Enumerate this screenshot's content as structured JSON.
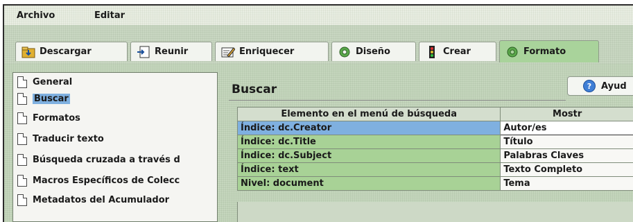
{
  "menubar": {
    "items": [
      "Archivo",
      "Editar"
    ]
  },
  "tabs": [
    {
      "label": "Descargar",
      "icon": "download-folder-icon",
      "active": false
    },
    {
      "label": "Reunir",
      "icon": "gather-document-icon",
      "active": false
    },
    {
      "label": "Enriquecer",
      "icon": "enrich-edit-icon",
      "active": false
    },
    {
      "label": "Diseño",
      "icon": "design-gear-icon",
      "active": false
    },
    {
      "label": "Crear",
      "icon": "create-traffic-light-icon",
      "active": false
    },
    {
      "label": "Formato",
      "icon": "format-gear-icon",
      "active": true
    }
  ],
  "sidebar": {
    "items": [
      {
        "label": "General",
        "selected": false
      },
      {
        "label": "Buscar",
        "selected": true
      },
      {
        "label": "Formatos",
        "selected": false
      },
      {
        "label": "Traducir texto",
        "selected": false
      },
      {
        "label": "Búsqueda cruzada a través d",
        "selected": false
      },
      {
        "label": "Macros Específicos de Colecc",
        "selected": false
      },
      {
        "label": "Metadatos del Acumulador",
        "selected": false
      }
    ]
  },
  "panel": {
    "title": "Buscar",
    "help_label": "Ayud",
    "table": {
      "headers": [
        "Elemento en el menú de búsqueda",
        "Mostr"
      ],
      "rows": [
        {
          "element": "Índice: dc.Creator",
          "shown": "Autor/es",
          "selected": true
        },
        {
          "element": "Índice: dc.Title",
          "shown": "Título",
          "selected": false
        },
        {
          "element": "Índice: dc.Subject",
          "shown": "Palabras Claves",
          "selected": false
        },
        {
          "element": "Índice: text",
          "shown": "Texto Completo",
          "selected": false
        },
        {
          "element": "Nivel: document",
          "shown": "Tema",
          "selected": false
        }
      ]
    }
  },
  "colors": {
    "active_tab": "#a9d39b",
    "selection": "#7fb0e0",
    "table_column": "#a8d296",
    "help_icon": "#3f7fd6"
  }
}
